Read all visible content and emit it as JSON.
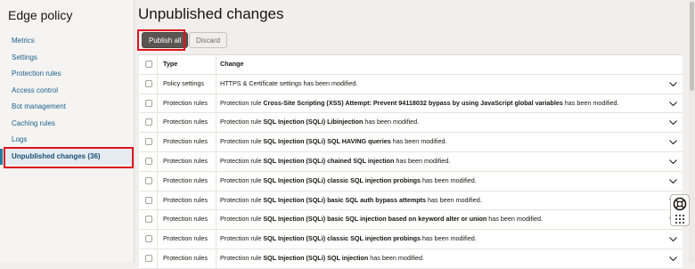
{
  "sidebar": {
    "title": "Edge policy",
    "items": [
      {
        "label": "Metrics"
      },
      {
        "label": "Settings"
      },
      {
        "label": "Protection rules"
      },
      {
        "label": "Access control"
      },
      {
        "label": "Bot management"
      },
      {
        "label": "Caching rules"
      },
      {
        "label": "Logs"
      },
      {
        "label": "Unpublished changes (36)",
        "active": true
      }
    ]
  },
  "main": {
    "title": "Unpublished changes",
    "publish_label": "Publish all",
    "discard_label": "Discard",
    "columns": {
      "type": "Type",
      "change": "Change"
    },
    "rows": [
      {
        "type": "Policy settings",
        "prefix": "",
        "bold": "",
        "suffix": "HTTPS & Certificate settings has been modified."
      },
      {
        "type": "Protection rules",
        "prefix": "Protection rule ",
        "bold": "Cross-Site Scripting (XSS) Attempt: Prevent 94118032 bypass by using JavaScript global variables",
        "suffix": " has been modified."
      },
      {
        "type": "Protection rules",
        "prefix": "Protection rule ",
        "bold": "SQL Injection (SQLi) Libinjection",
        "suffix": " has been modified."
      },
      {
        "type": "Protection rules",
        "prefix": "Protection rule ",
        "bold": "SQL Injection (SQLi) SQL HAVING queries",
        "suffix": " has been modified."
      },
      {
        "type": "Protection rules",
        "prefix": "Protection rule ",
        "bold": "SQL Injection (SQLi) chained SQL injection",
        "suffix": " has been modified."
      },
      {
        "type": "Protection rules",
        "prefix": "Protection rule ",
        "bold": "SQL Injection (SQLi) classic SQL injection probings",
        "suffix": " has been modified."
      },
      {
        "type": "Protection rules",
        "prefix": "Protection rule ",
        "bold": "SQL Injection (SQLi) basic SQL auth bypass attempts",
        "suffix": " has been modified."
      },
      {
        "type": "Protection rules",
        "prefix": "Protection rule ",
        "bold": "SQL Injection (SQLi) basic SQL injection based on keyword alter or union",
        "suffix": " has been modified."
      },
      {
        "type": "Protection rules",
        "prefix": "Protection rule ",
        "bold": "SQL Injection (SQLi) classic SQL injection probings",
        "suffix": " has been modified."
      },
      {
        "type": "Protection rules",
        "prefix": "Protection rule ",
        "bold": "SQL Injection (SQLi) SQL injection",
        "suffix": " has been modified."
      }
    ]
  },
  "colors": {
    "highlight": "#e0121e",
    "primary_button": "#5c5450",
    "link": "#1b5f8c",
    "active_nav_bg": "#e4ecf1"
  },
  "icons": [
    "chevron-down-icon",
    "lifebuoy-icon",
    "grid-dots-icon"
  ]
}
